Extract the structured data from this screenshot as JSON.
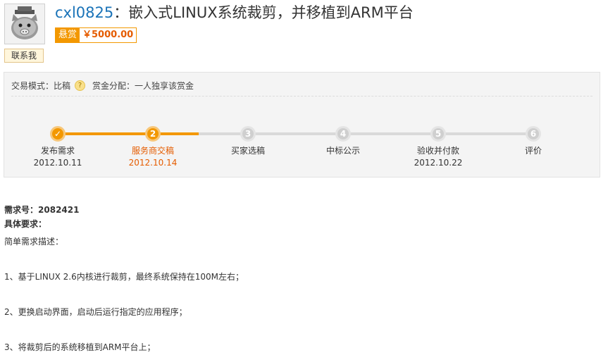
{
  "header": {
    "username": "cxl0825",
    "title_separator": "：",
    "title_text": "嵌入式LINUX系统裁剪，并移植到ARM平台",
    "bounty_label": "悬赏",
    "bounty_amount": "￥5000.00",
    "contact_label": "联系我",
    "avatar_icon": "pig-avatar-icon"
  },
  "process": {
    "mode_label": "交易模式：",
    "mode_value": "比稿",
    "help_glyph": "?",
    "distribution_label": "赏金分配：",
    "distribution_value": "一人独享该赏金",
    "steps": [
      {
        "number": "✓",
        "label": "发布需求",
        "date": "2012.10.11",
        "state": "done"
      },
      {
        "number": "2",
        "label": "服务商交稿",
        "date": "2012.10.14",
        "state": "current"
      },
      {
        "number": "3",
        "label": "买家选稿",
        "date": "",
        "state": "todo"
      },
      {
        "number": "4",
        "label": "中标公示",
        "date": "",
        "state": "todo"
      },
      {
        "number": "5",
        "label": "验收并付款",
        "date": "2012.10.22",
        "state": "todo"
      },
      {
        "number": "6",
        "label": "评价",
        "date": "",
        "state": "todo"
      }
    ]
  },
  "detail": {
    "id_label": "需求号：",
    "id_value": "2082421",
    "req_label": "具体要求：",
    "lines": [
      "简单需求描述：",
      "1、基于LINUX 2.6内核进行裁剪，最终系统保持在100M左右；",
      "2、更换启动界面，启动后运行指定的应用程序；",
      "3、将裁剪后的系统移植到ARM平台上；"
    ]
  },
  "colors": {
    "accent": "#f39800",
    "link": "#1a73b8",
    "current_text": "#e55c00"
  }
}
